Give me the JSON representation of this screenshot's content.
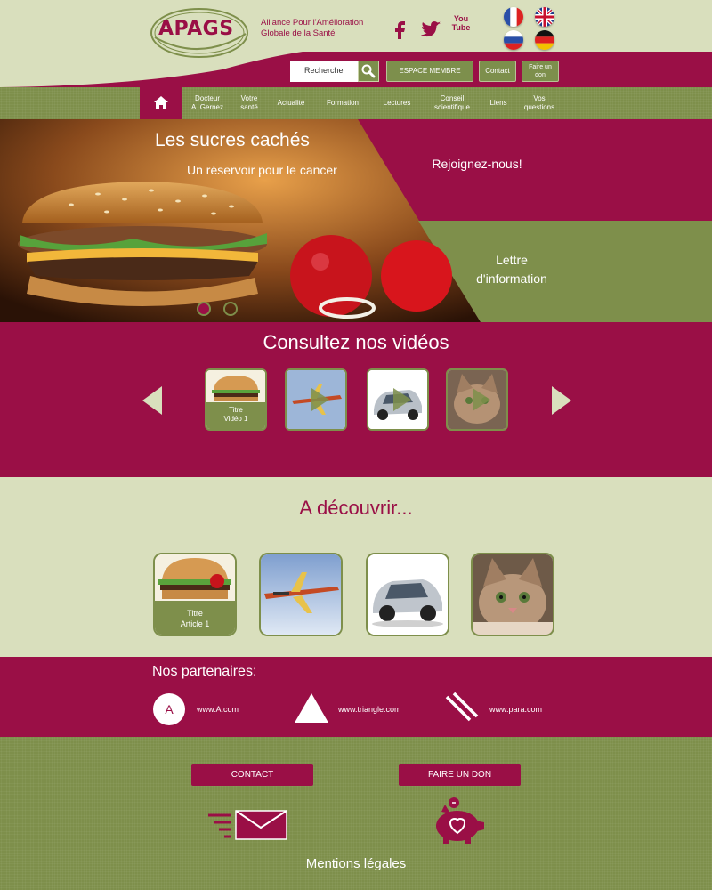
{
  "colors": {
    "brand": "#9a0f46",
    "green": "#7e8f4b",
    "cream": "#d9dfbd"
  },
  "header": {
    "logo_text": "APAGS",
    "tagline_line1": "Alliance Pour l'Amélioration",
    "tagline_line2": "Globale de la Santé",
    "social": [
      "facebook-icon",
      "twitter-icon",
      "youtube-icon"
    ],
    "youtube_label": "You Tube",
    "flags": [
      "france",
      "united-kingdom",
      "russia",
      "germany"
    ],
    "search_placeholder": "Recherche",
    "member_label": "ESPACE MEMBRE",
    "contact_label": "Contact",
    "donate_line1": "Faire un",
    "donate_line2": "don"
  },
  "nav": {
    "items": [
      {
        "line1": "Docteur",
        "line2": "A. Gernez"
      },
      {
        "line1": "Votre",
        "line2": "santé"
      },
      {
        "line1": "Actualité",
        "line2": ""
      },
      {
        "line1": "Formation",
        "line2": ""
      },
      {
        "line1": "Lectures",
        "line2": ""
      },
      {
        "line1": "Conseil",
        "line2": "scientifique"
      },
      {
        "line1": "Liens",
        "line2": ""
      },
      {
        "line1": "Vos",
        "line2": "questions"
      }
    ]
  },
  "hero": {
    "title": "Les sucres cachés",
    "subtitle": "Un réservoir pour le cancer",
    "join": "Rejoignez-nous!",
    "newsletter_line1": "Lettre",
    "newsletter_line2": "d'information"
  },
  "videos": {
    "title": "Consultez nos vidéos",
    "first_caption_line1": "Titre",
    "first_caption_line2": "Vidéo 1"
  },
  "discover": {
    "title": "A découvrir...",
    "first_caption_line1": "Titre",
    "first_caption_line2": "Article 1"
  },
  "partners": {
    "title": "Nos partenaires:",
    "a_letter": "A",
    "links": [
      "www.A.com",
      "www.triangle.com",
      "www.para.com"
    ]
  },
  "footer": {
    "contact": "CONTACT",
    "donate": "FAIRE UN DON",
    "mentions": "Mentions légales"
  }
}
